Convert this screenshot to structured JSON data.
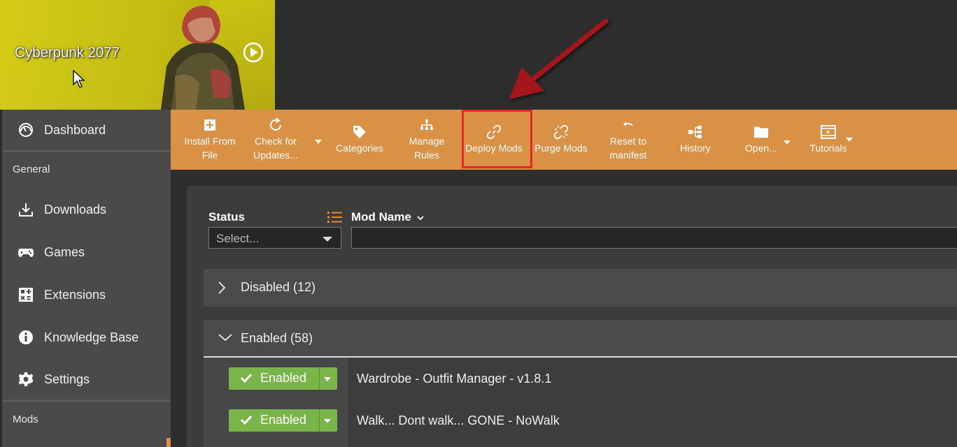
{
  "banner": {
    "game_title": "Cyberpunk 2077",
    "play_icon": "play-icon"
  },
  "sidebar": {
    "dashboard": {
      "label": "Dashboard",
      "icon": "gauge-icon"
    },
    "section_general": "General",
    "items": [
      {
        "label": "Downloads",
        "icon": "download-icon"
      },
      {
        "label": "Games",
        "icon": "gamepad-icon"
      },
      {
        "label": "Extensions",
        "icon": "extensions-icon"
      },
      {
        "label": "Knowledge Base",
        "icon": "info-icon"
      },
      {
        "label": "Settings",
        "icon": "gear-icon"
      }
    ],
    "section_mods": "Mods"
  },
  "toolbar": {
    "install_from_file": "Install From File",
    "check_for_updates": "Check for Updates...",
    "categories": "Categories",
    "manage_rules": "Manage Rules",
    "deploy_mods": "Deploy Mods",
    "purge_mods": "Purge Mods",
    "reset_to_manifest": "Reset to manifest",
    "history": "History",
    "open": "Open...",
    "tutorials": "Tutorials",
    "background": "#d99146",
    "highlight": "#e8262a"
  },
  "table": {
    "columns": {
      "status": "Status",
      "mod_name": "Mod Name"
    },
    "status_filter_placeholder": "Select...",
    "groups": [
      {
        "label": "Disabled (12)",
        "expanded": false
      },
      {
        "label": "Enabled (58)",
        "expanded": true
      }
    ],
    "rows": [
      {
        "status": "Enabled",
        "name": "Wardrobe - Outfit Manager - v1.8.1"
      },
      {
        "status": "Enabled",
        "name": "Walk... Dont walk... GONE - NoWalk"
      }
    ],
    "enabled_color": "#7ab54a"
  }
}
